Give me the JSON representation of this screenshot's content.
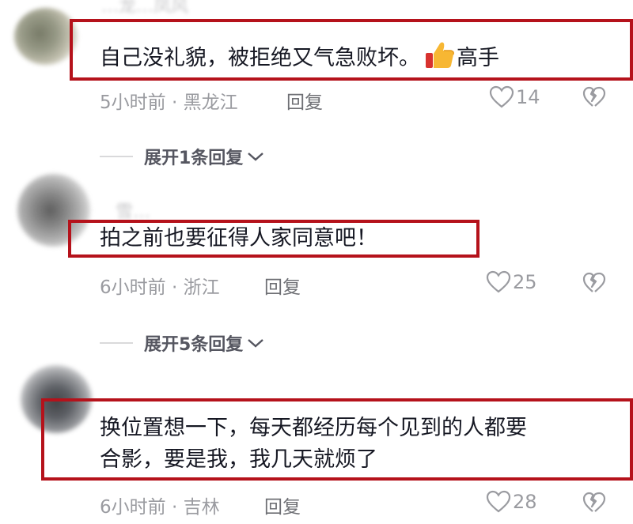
{
  "colors": {
    "highlight_border": "#b5121b",
    "meta_gray": "#9a9ba0",
    "text": "#161823"
  },
  "comments": [
    {
      "username": "…龙…凤风",
      "text": "自己没礼貌，被拒绝又气急败坏。",
      "emoji": "thumbs-up-icon",
      "text_suffix": "高手",
      "time_location": "5小时前 · 黑龙江",
      "reply_label": "回复",
      "likes": "14",
      "expand_label": "展开1条回复"
    },
    {
      "username": "雪…",
      "text": "拍之前也要征得人家同意吧！",
      "time_location": "6小时前 · 浙江",
      "reply_label": "回复",
      "likes": "25",
      "expand_label": "展开5条回复"
    },
    {
      "username": "",
      "text_line1": "换位置想一下，每天都经历每个见到的人都要",
      "text_line2": "合影，要是我，我几天就烦了",
      "time_location": "6小时前 · 吉林",
      "reply_label": "回复",
      "likes": "28"
    }
  ]
}
